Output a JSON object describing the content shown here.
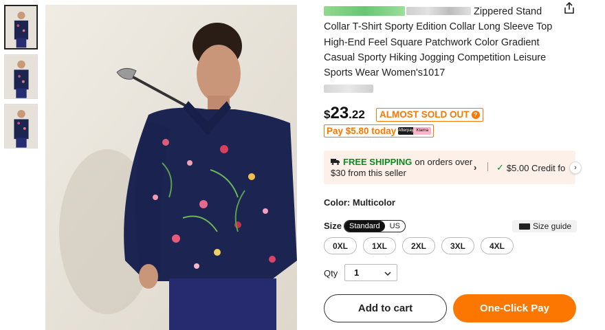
{
  "thumbnails": [
    {
      "label": "thumbnail-1",
      "active": true
    },
    {
      "label": "thumbnail-2",
      "active": false
    },
    {
      "label": "thumbnail-3",
      "active": false
    }
  ],
  "product": {
    "title_text": " Zippered Stand Collar T-Shirt Sporty Edition Collar Long Sleeve Top High-End Feel Square Patchwork Color Gradient Casual Sporty Hiking Jogging Competition Leisure Sports Wear Women's1017",
    "price_symbol": "$",
    "price_integer": "23",
    "price_decimal": ".22",
    "stock_badge": "ALMOST SOLD OUT",
    "pay_later_text": "Pay $5.80 today",
    "pay_logo_a": "Afterpay",
    "pay_logo_b": "Klarna"
  },
  "shipping": {
    "free_label": "FREE SHIPPING",
    "line1_rest": " on orders over",
    "line2": "$30 from this seller",
    "credit_text": "$5.00 Credit fo"
  },
  "options": {
    "color_label": "Color: Multicolor",
    "size_label": "Size",
    "size_standard": "Standard",
    "size_us": "US",
    "size_guide": "Size guide",
    "sizes": [
      "0XL",
      "1XL",
      "2XL",
      "3XL",
      "4XL"
    ],
    "qty_label": "Qty",
    "qty_value": "1"
  },
  "actions": {
    "add_to_cart": "Add to cart",
    "one_click_pay": "One-Click Pay"
  },
  "colors": {
    "accent": "#fb7701",
    "free_shipping_green": "#0a8a1f",
    "shipping_bg": "#fdf0e8"
  }
}
